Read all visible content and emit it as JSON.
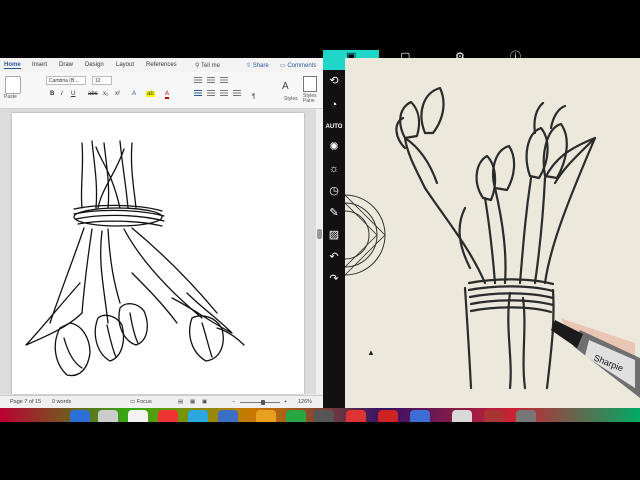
{
  "word": {
    "tabs": [
      "Home",
      "Insert",
      "Draw",
      "Design",
      "Layout",
      "References"
    ],
    "tell_me": "Tell me",
    "share": "Share",
    "comments": "Comments",
    "paste_label": "Paste",
    "font_name": "Cambria (B...",
    "font_size": "12",
    "format_buttons": [
      "B",
      "I",
      "U",
      "abc",
      "x₂",
      "x²"
    ],
    "styles_label": "Styles",
    "styles_pane_label": "Styles Pane",
    "status": {
      "page": "Page 7 of 15",
      "words": "0 words",
      "focus": "Focus",
      "zoom": "126%"
    }
  },
  "toolbar": {
    "auto_label": "AUTO",
    "icons": [
      "camera-switch-icon",
      "timer-icon",
      "auto-label",
      "aperture-icon",
      "brightness-icon",
      "clock-icon",
      "draw-icon",
      "annotate-icon",
      "undo-icon",
      "redo-icon"
    ]
  },
  "top_icons": [
    "photo-icon",
    "settings-icon",
    "info-icon"
  ],
  "camera": {
    "marker_brand": "Sharpie"
  },
  "colors": {
    "accent_teal": "#1fd6c8",
    "word_blue": "#2b579a"
  }
}
